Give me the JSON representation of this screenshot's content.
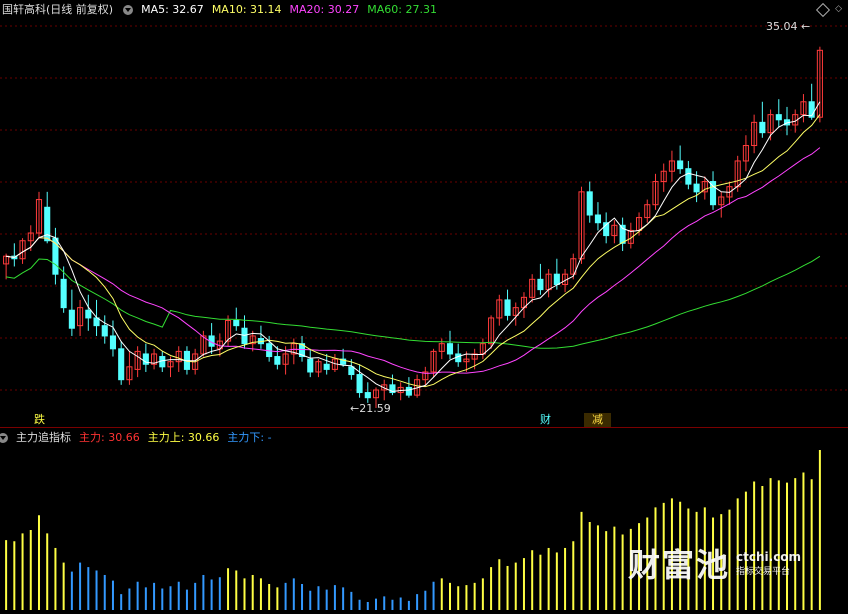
{
  "main_legend": {
    "title": "国轩高科(日线 前复权)",
    "ma5": {
      "label": "MA5: 32.67",
      "color": "#ffffff"
    },
    "ma10": {
      "label": "MA10: 31.14",
      "color": "#ffff66"
    },
    "ma20": {
      "label": "MA20: 30.27",
      "color": "#ff44ff"
    },
    "ma60": {
      "label": "MA60: 27.31",
      "color": "#33dd33"
    }
  },
  "indicator_legend": {
    "title": "主力追指标",
    "main": {
      "label": "主力: 30.66",
      "color": "#ff3333"
    },
    "upper": {
      "label": "主力上: 30.66",
      "color": "#ffff44"
    },
    "lower": {
      "label": "主力下: -",
      "color": "#3399ff"
    }
  },
  "annotations": {
    "high": "35.04",
    "low": "21.59",
    "signal_die": "跌",
    "signal_cai": "财",
    "signal_zhi": "减"
  },
  "watermark": {
    "brand": "财富池",
    "url": "ctchi.com",
    "slogan": "指标交易平台"
  },
  "colors": {
    "up": "#ff3b3b",
    "down": "#54ffff",
    "grid": "#6a0000",
    "bar_up": "#ffff44",
    "bar_down": "#3399ff"
  },
  "chart_data": {
    "type": "candlestick",
    "price_range": [
      21.0,
      36.0
    ],
    "candles": [
      [
        26.6,
        27.0,
        26.0,
        26.9
      ],
      [
        26.9,
        27.4,
        26.5,
        26.8
      ],
      [
        26.8,
        27.6,
        26.6,
        27.5
      ],
      [
        27.5,
        28.1,
        27.1,
        27.8
      ],
      [
        27.8,
        29.4,
        27.6,
        29.1
      ],
      [
        28.8,
        29.4,
        27.4,
        27.5
      ],
      [
        27.6,
        28.0,
        25.8,
        26.2
      ],
      [
        26.0,
        26.5,
        24.7,
        24.9
      ],
      [
        24.8,
        25.6,
        23.8,
        24.1
      ],
      [
        24.2,
        25.2,
        23.8,
        24.9
      ],
      [
        24.8,
        25.4,
        24.0,
        24.5
      ],
      [
        24.5,
        25.2,
        23.8,
        24.2
      ],
      [
        24.2,
        24.6,
        23.5,
        23.8
      ],
      [
        23.8,
        24.4,
        23.0,
        23.3
      ],
      [
        23.3,
        23.6,
        21.9,
        22.1
      ],
      [
        22.1,
        23.2,
        21.9,
        22.6
      ],
      [
        22.5,
        23.4,
        22.2,
        23.2
      ],
      [
        23.1,
        23.5,
        22.4,
        22.7
      ],
      [
        22.7,
        23.3,
        22.5,
        23.1
      ],
      [
        23.0,
        23.2,
        22.4,
        22.6
      ],
      [
        22.6,
        23.0,
        22.2,
        22.8
      ],
      [
        22.8,
        23.4,
        22.4,
        23.2
      ],
      [
        23.2,
        23.4,
        22.3,
        22.5
      ],
      [
        22.5,
        23.3,
        22.3,
        23.1
      ],
      [
        23.1,
        24.0,
        23.0,
        23.8
      ],
      [
        23.8,
        24.3,
        23.1,
        23.4
      ],
      [
        23.3,
        23.9,
        23.0,
        23.6
      ],
      [
        23.6,
        24.6,
        23.4,
        24.4
      ],
      [
        24.4,
        24.9,
        24.0,
        24.2
      ],
      [
        24.1,
        24.6,
        23.3,
        23.5
      ],
      [
        23.5,
        24.0,
        23.2,
        23.8
      ],
      [
        23.7,
        24.2,
        23.3,
        23.5
      ],
      [
        23.5,
        23.8,
        22.8,
        23.0
      ],
      [
        23.0,
        23.4,
        22.5,
        22.7
      ],
      [
        22.7,
        23.4,
        22.3,
        23.1
      ],
      [
        23.1,
        23.7,
        22.7,
        23.5
      ],
      [
        23.5,
        23.8,
        22.8,
        23.0
      ],
      [
        22.9,
        23.3,
        22.2,
        22.4
      ],
      [
        22.4,
        22.9,
        22.2,
        22.8
      ],
      [
        22.7,
        23.1,
        22.3,
        22.5
      ],
      [
        22.5,
        23.1,
        22.4,
        22.9
      ],
      [
        22.9,
        23.3,
        22.6,
        22.7
      ],
      [
        22.6,
        22.9,
        22.1,
        22.3
      ],
      [
        22.3,
        22.7,
        21.4,
        21.6
      ],
      [
        21.6,
        22.0,
        21.2,
        21.4
      ],
      [
        21.4,
        21.8,
        21.0,
        21.7
      ],
      [
        21.7,
        22.1,
        21.3,
        21.9
      ],
      [
        21.9,
        22.3,
        21.5,
        21.6
      ],
      [
        21.6,
        22.0,
        21.3,
        21.8
      ],
      [
        21.8,
        22.2,
        21.4,
        21.5
      ],
      [
        21.5,
        22.3,
        21.4,
        22.1
      ],
      [
        22.1,
        22.6,
        21.9,
        22.4
      ],
      [
        22.4,
        23.3,
        22.2,
        23.2
      ],
      [
        23.2,
        23.7,
        22.9,
        23.5
      ],
      [
        23.5,
        24.0,
        22.9,
        23.1
      ],
      [
        23.1,
        23.5,
        22.6,
        22.8
      ],
      [
        22.8,
        23.2,
        22.4,
        22.9
      ],
      [
        22.9,
        23.3,
        22.5,
        23.1
      ],
      [
        23.1,
        23.7,
        22.9,
        23.5
      ],
      [
        23.5,
        24.6,
        23.3,
        24.5
      ],
      [
        24.5,
        25.4,
        24.2,
        25.2
      ],
      [
        25.2,
        25.6,
        24.4,
        24.6
      ],
      [
        24.6,
        25.1,
        24.2,
        24.9
      ],
      [
        24.9,
        25.5,
        24.5,
        25.3
      ],
      [
        25.3,
        26.2,
        25.1,
        26.0
      ],
      [
        26.0,
        26.6,
        25.4,
        25.6
      ],
      [
        25.6,
        26.4,
        25.3,
        26.2
      ],
      [
        26.2,
        26.8,
        25.6,
        25.8
      ],
      [
        25.8,
        26.4,
        25.5,
        26.2
      ],
      [
        26.2,
        27.0,
        26.0,
        26.8
      ],
      [
        26.8,
        29.6,
        26.6,
        29.4
      ],
      [
        29.4,
        29.8,
        28.2,
        28.5
      ],
      [
        28.5,
        29.0,
        27.9,
        28.2
      ],
      [
        28.2,
        28.6,
        27.4,
        27.7
      ],
      [
        27.7,
        28.3,
        27.4,
        28.1
      ],
      [
        28.1,
        28.4,
        27.1,
        27.4
      ],
      [
        27.4,
        28.2,
        27.2,
        27.9
      ],
      [
        27.9,
        28.6,
        27.7,
        28.4
      ],
      [
        28.4,
        29.1,
        28.2,
        28.9
      ],
      [
        28.9,
        30.1,
        28.7,
        29.8
      ],
      [
        29.8,
        30.5,
        29.4,
        30.2
      ],
      [
        30.2,
        31.0,
        29.8,
        30.6
      ],
      [
        30.6,
        31.2,
        30.1,
        30.3
      ],
      [
        30.3,
        30.6,
        29.5,
        29.7
      ],
      [
        29.7,
        30.2,
        29.0,
        29.4
      ],
      [
        29.4,
        30.0,
        29.1,
        29.8
      ],
      [
        29.8,
        30.2,
        28.7,
        28.9
      ],
      [
        28.9,
        29.4,
        28.4,
        29.2
      ],
      [
        29.2,
        29.8,
        28.9,
        29.6
      ],
      [
        29.6,
        30.8,
        29.4,
        30.6
      ],
      [
        30.6,
        31.6,
        30.2,
        31.2
      ],
      [
        31.2,
        32.4,
        30.9,
        32.1
      ],
      [
        32.1,
        32.9,
        31.5,
        31.7
      ],
      [
        31.7,
        32.6,
        31.4,
        32.4
      ],
      [
        32.4,
        33.0,
        31.9,
        32.2
      ],
      [
        32.2,
        32.7,
        31.6,
        32.0
      ],
      [
        32.0,
        32.6,
        31.7,
        32.4
      ],
      [
        32.4,
        33.2,
        32.1,
        32.9
      ],
      [
        32.9,
        33.6,
        32.2,
        32.3
      ],
      [
        32.3,
        35.04,
        32.1,
        34.9
      ]
    ]
  }
}
